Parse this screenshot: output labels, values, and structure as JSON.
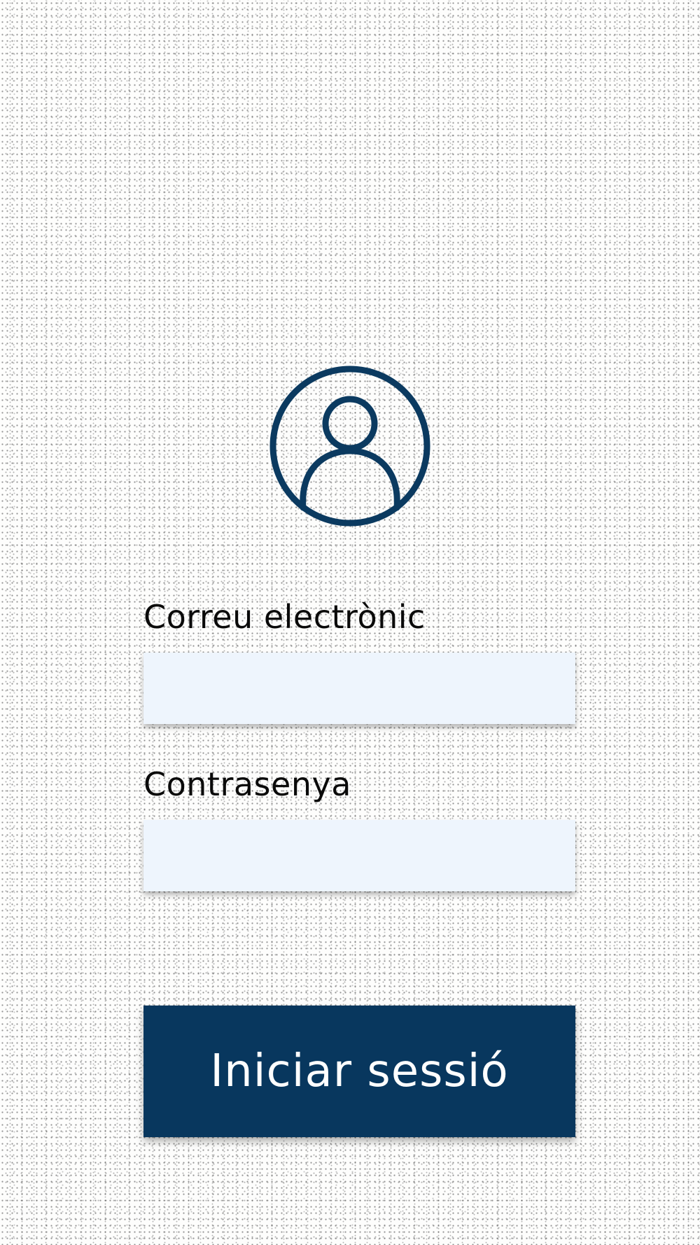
{
  "avatar": {
    "icon": "user-circle-icon",
    "color": "#0b3a60"
  },
  "form": {
    "email_label": "Correu electrònic",
    "email_value": "",
    "password_label": "Contrasenya",
    "password_value": "",
    "submit_label": "Iniciar sessió"
  },
  "colors": {
    "button_background": "#08375e",
    "input_background": "#eef5fd"
  }
}
